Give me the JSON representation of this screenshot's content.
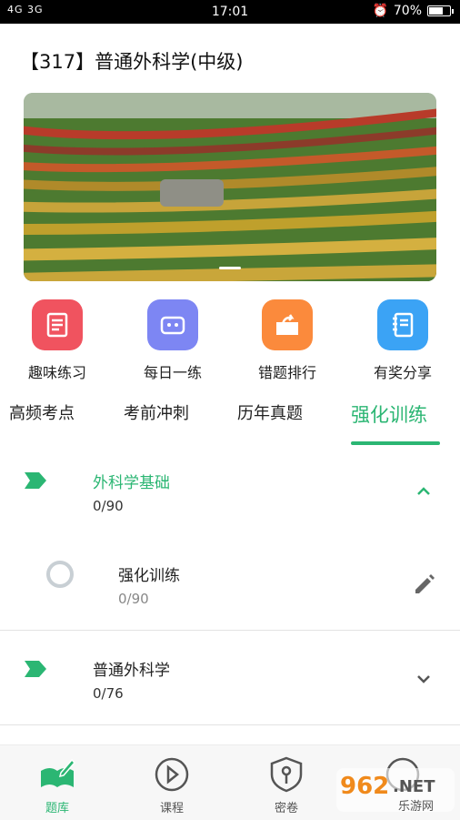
{
  "status_bar": {
    "signal_text": "4G 3G",
    "time": "17:01",
    "battery": "70%",
    "battery_level": 0.7
  },
  "page_title": "【317】普通外科学(中级)",
  "quick_actions": [
    {
      "label": "趣味练习",
      "icon": "checklist-icon",
      "color": "#f0535f"
    },
    {
      "label": "每日一练",
      "icon": "robot-icon",
      "color": "#7d86f3"
    },
    {
      "label": "错题排行",
      "icon": "share-folder-icon",
      "color": "#fb8a3c"
    },
    {
      "label": "有奖分享",
      "icon": "notebook-icon",
      "color": "#3ba3f5"
    }
  ],
  "tabs": [
    "高频考点",
    "考前冲刺",
    "历年真题",
    "强化训练"
  ],
  "active_tab": "强化训练",
  "accent_color": "#2bb673",
  "sections": [
    {
      "title": "外科学基础",
      "count": "0/90",
      "expanded": true,
      "children": [
        {
          "title": "强化训练",
          "count": "0/90"
        }
      ]
    },
    {
      "title": "普通外科学",
      "count": "0/76",
      "expanded": false
    }
  ],
  "bottom_nav": [
    {
      "label": "题库",
      "icon": "book-pen-icon",
      "active": true
    },
    {
      "label": "课程",
      "icon": "play-circle-icon",
      "active": false
    },
    {
      "label": "密卷",
      "icon": "shield-key-icon",
      "active": false
    },
    {
      "label": "",
      "icon": "user-icon",
      "active": false
    }
  ],
  "watermark": {
    "text": "962.NET",
    "subtext": "乐游网"
  }
}
